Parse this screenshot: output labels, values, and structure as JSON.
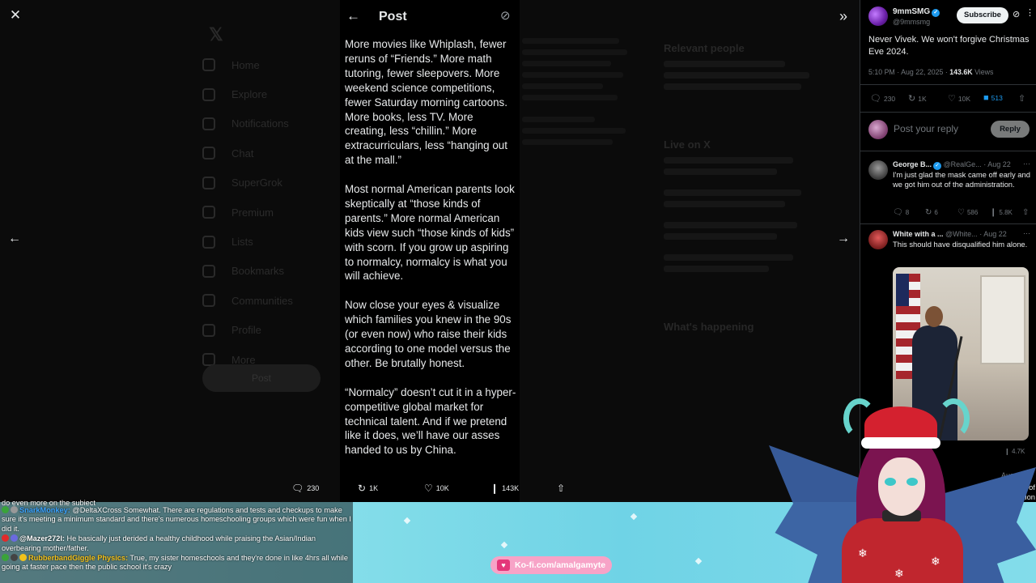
{
  "background": {
    "nav_items": [
      "Home",
      "Explore",
      "Notifications",
      "Chat",
      "SuperGrok",
      "Premium",
      "Lists",
      "Bookmarks",
      "Communities",
      "Profile",
      "More"
    ],
    "post_button": "Post",
    "relevant_people": "Relevant people",
    "live_on_x": "Live on X",
    "whats_happening": "What's happening"
  },
  "modal": {
    "close_label": "✕",
    "header_title": "Post",
    "paragraphs": [
      "More movies like Whiplash, fewer reruns of “Friends.” More math tutoring, fewer sleepovers. More weekend science competitions, fewer Saturday morning cartoons. More books, less TV. More creating, less “chillin.” More extracurriculars, less “hanging out at the mall.”",
      "Most normal American parents look skeptically at “those kinds of parents.” More normal American kids view such “those kinds of kids” with scorn. If you grow up aspiring to normalcy, normalcy is what you will achieve.",
      "Now close your eyes & visualize which families you knew in the 90s (or even now) who raise their kids according to one model versus the other. Be brutally honest.",
      "“Normalcy” doesn’t cut it in a hyper-competitive global market for technical talent. And if we pretend like it does, we’ll have our asses handed to us by China."
    ],
    "actions": {
      "replies": "230",
      "reposts": "1K",
      "likes": "10K",
      "views": "143K"
    }
  },
  "right_panel": {
    "author_name": "9mmSMG",
    "author_handle": "@9mmsmg",
    "subscribe_label": "Subscribe",
    "post_text": "Never Vivek. We won't forgive Christmas Eve 2024.",
    "time": "5:10 PM · Aug 22, 2025 · ",
    "views_count": "143.6K",
    "views_label": " Views",
    "stats": {
      "replies": "230",
      "reposts": "1K",
      "likes": "10K",
      "bookmarks": "513"
    },
    "reply_placeholder": "Post your reply",
    "reply_button": "Reply",
    "replies": [
      {
        "name": "George B...",
        "handle": "@RealGe...",
        "date": "· Aug 22",
        "text": "I'm just glad the mask came off early and we got him out of the administration.",
        "replies": "8",
        "reposts": "6",
        "likes": "586",
        "views": "5.8K"
      },
      {
        "name": "White with a ...",
        "handle": "@White...",
        "date": "· Aug 22",
        "text": "This should have disqualified him alone.",
        "views": "4.7K"
      }
    ],
    "partial_reply": {
      "date": "Aug 22",
      "text1": "im a debt of",
      "text2": "/ opposition"
    }
  },
  "stream": {
    "chat": [
      {
        "user": "",
        "text": "do even more on the subject",
        "color": "#ffffff"
      },
      {
        "user": "SnarkMonkey:",
        "text": " @DeltaXCross Somewhat. There are regulations and tests and checkups to make sure it's meeting a minimum standard and there's numerous homeschooling groups which were fun when I did it.",
        "color": "#3aa3ff"
      },
      {
        "user": "@Mazer272l:",
        "text": " He basically just derided a healthy childhood while praising the Asian/Indian overbearing mother/father.",
        "color": "#ffffff"
      },
      {
        "user": "RubberbandGiggle Physics:",
        "text": " True, my sister homeschools and they're done in like 4hrs all while going at faster pace then the public school it's crazy",
        "color": "#f2c21b"
      }
    ],
    "kofi_label": "Ko-fi.com/amalgamyte"
  },
  "colors": {
    "accent": "#1d9bf0",
    "stream_bg": "#7fdbe8",
    "kofi": "#f7a3c7"
  }
}
